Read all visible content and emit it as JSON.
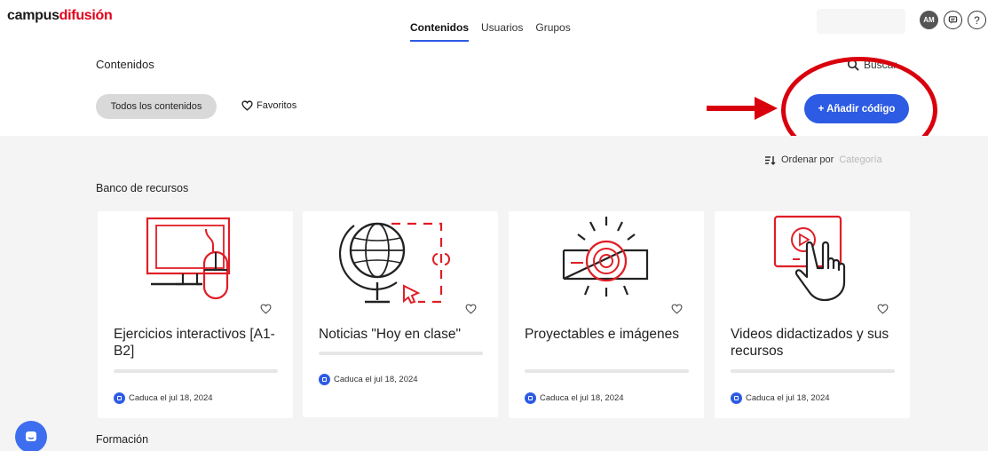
{
  "brand": {
    "part1": "campus",
    "part2": "difusión"
  },
  "nav": {
    "tabs": [
      "Contenidos",
      "Usuarios",
      "Grupos"
    ]
  },
  "user": {
    "initials": "AM"
  },
  "header": {
    "title": "Contenidos",
    "search_label": "Buscar"
  },
  "filters": {
    "all": "Todos los contenidos",
    "favorites": "Favoritos"
  },
  "actions": {
    "add_code": "+ Añadir código"
  },
  "sort": {
    "label": "Ordenar por",
    "value": "Categoría"
  },
  "sections": {
    "bank": "Banco de recursos",
    "training": "Formación"
  },
  "cards": [
    {
      "title": "Ejercicios interactivos [A1-B2]",
      "expiry": "Caduca el jul 18, 2024",
      "icon": "computer-mouse-icon"
    },
    {
      "title": "Noticias \"Hoy en clase\"",
      "expiry": "Caduca el jul 18, 2024",
      "icon": "globe-icon"
    },
    {
      "title": "Proyectables e imágenes",
      "expiry": "Caduca el jul 18, 2024",
      "icon": "projector-icon"
    },
    {
      "title": "Videos didactizados y sus recursos",
      "expiry": "Caduca el jul 18, 2024",
      "icon": "video-touch-icon"
    }
  ],
  "colors": {
    "accent": "#2d5be3",
    "brand_red": "#e3001b",
    "annotation": "#d9000d"
  }
}
